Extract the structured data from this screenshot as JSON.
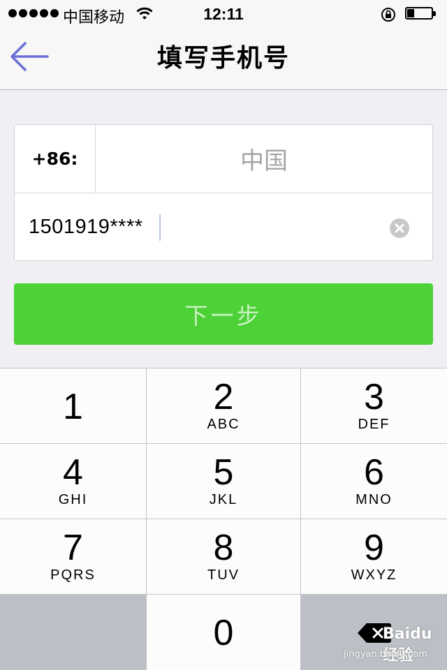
{
  "status_bar": {
    "carrier": "中国移动",
    "time": "12:11",
    "battery_level": 0.3
  },
  "navbar": {
    "title": "填写手机号"
  },
  "form": {
    "country_code": "+86:",
    "country_name": "中国",
    "phone_value": "1501919****"
  },
  "next_button": {
    "label": "下一步"
  },
  "keypad": {
    "keys": [
      {
        "num": "1",
        "letters": ""
      },
      {
        "num": "2",
        "letters": "ABC"
      },
      {
        "num": "3",
        "letters": "DEF"
      },
      {
        "num": "4",
        "letters": "GHI"
      },
      {
        "num": "5",
        "letters": "JKL"
      },
      {
        "num": "6",
        "letters": "MNO"
      },
      {
        "num": "7",
        "letters": "PQRS"
      },
      {
        "num": "8",
        "letters": "TUV"
      },
      {
        "num": "9",
        "letters": "WXYZ"
      },
      {
        "num": "0",
        "letters": ""
      }
    ]
  },
  "watermark": {
    "text": "Baidu 经验",
    "url": "jingyan.baidu.com"
  },
  "colors": {
    "accent_green": "#4cd137",
    "back_arrow": "#6a6ed6"
  }
}
